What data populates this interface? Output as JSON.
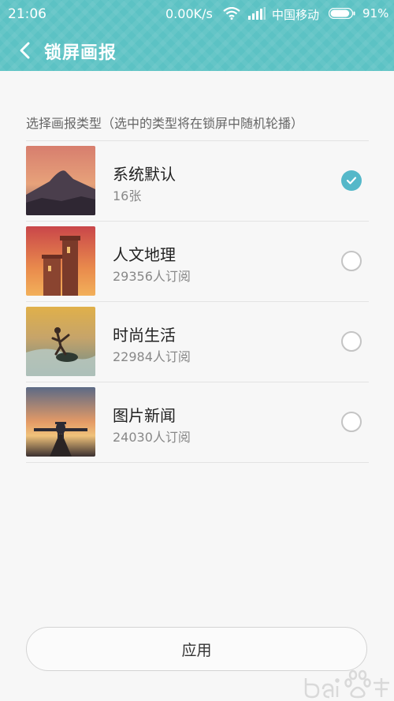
{
  "status": {
    "time": "21:06",
    "speed": "0.00K/s",
    "carrier": "中国移动",
    "battery": "91%",
    "battery_level": 0.91
  },
  "header": {
    "title": "锁屏画报",
    "accent_color": "#5cc2c4"
  },
  "section_label": "选择画报类型（选中的类型将在锁屏中随机轮播）",
  "items": [
    {
      "title": "系统默认",
      "subtitle": "16张",
      "checked": true,
      "thumb_icon": "mountain-sunset-icon"
    },
    {
      "title": "人文地理",
      "subtitle": "29356人订阅",
      "checked": false,
      "thumb_icon": "castle-tower-icon"
    },
    {
      "title": "时尚生活",
      "subtitle": "22984人订阅",
      "checked": false,
      "thumb_icon": "surfer-icon"
    },
    {
      "title": "图片新闻",
      "subtitle": "24030人订阅",
      "checked": false,
      "thumb_icon": "airplane-icon"
    }
  ],
  "apply_label": "应用",
  "check_color": "#55b8c9"
}
